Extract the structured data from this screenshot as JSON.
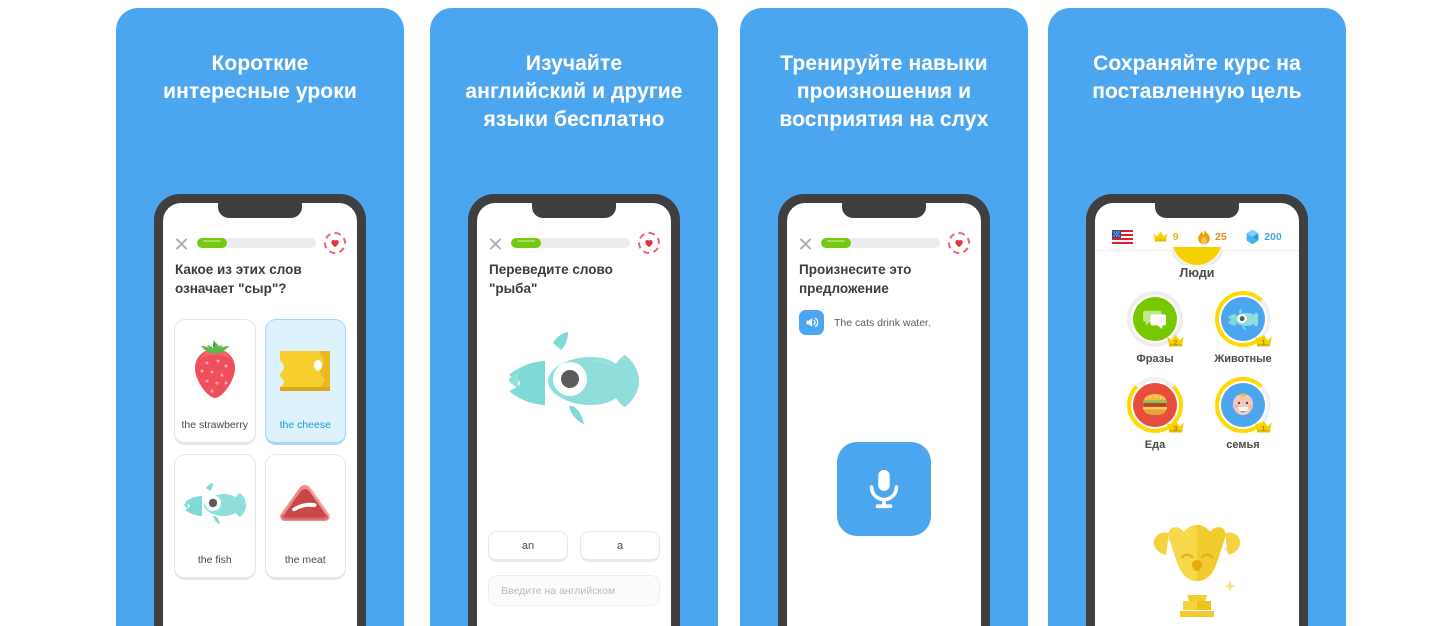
{
  "theme": {
    "panel_blue": "#4ca5ef",
    "phone_frame": "#3f3f3f",
    "progress_green": "#76c913",
    "heart_red": "#e8606a",
    "crown_gold": "#ffd900",
    "page_bg": "#ffffff"
  },
  "panels": [
    {
      "caption_lines": [
        "Короткие",
        "интересные уроки"
      ],
      "screen": {
        "kind": "multiple-choice",
        "close_icon": "close-icon",
        "progress_percent": 25,
        "hearts_icon": "heart-icon",
        "prompt_lines": [
          "Какое из этих слов",
          "означает \"сыр\"?"
        ],
        "choices": [
          {
            "label": "the strawberry",
            "art": "strawberry-illustration",
            "selected": false
          },
          {
            "label": "the cheese",
            "art": "cheese-illustration",
            "selected": true
          },
          {
            "label": "the fish",
            "art": "fish-illustration",
            "selected": false
          },
          {
            "label": "the meat",
            "art": "meat-illustration",
            "selected": false
          }
        ]
      }
    },
    {
      "caption_lines": [
        "Изучайте",
        "английский и другие",
        "языки бесплатно"
      ],
      "screen": {
        "kind": "translate",
        "close_icon": "close-icon",
        "progress_percent": 25,
        "hearts_icon": "heart-icon",
        "prompt_lines": [
          "Переведите слово \"рыба\""
        ],
        "illustration": "fish-illustration",
        "word_chips": [
          "an",
          "a"
        ],
        "input_placeholder": "Введите на английском",
        "input_value": ""
      }
    },
    {
      "caption_lines": [
        "Тренируйте навыки",
        "произношения и",
        "восприятия на слух"
      ],
      "screen": {
        "kind": "speak",
        "close_icon": "close-icon",
        "progress_percent": 25,
        "hearts_icon": "heart-icon",
        "prompt_lines": [
          "Произнесите это",
          "предложение"
        ],
        "speaker_icon": "speaker-icon",
        "sentence": "The cats drink water.",
        "mic_icon": "microphone-icon"
      }
    },
    {
      "caption_lines": [
        "Сохраняйте курс на",
        "поставленную цель"
      ],
      "screen": {
        "kind": "home",
        "stats": [
          {
            "icon": "us-flag-icon",
            "value": ""
          },
          {
            "icon": "crown-icon",
            "value": "9"
          },
          {
            "icon": "flame-icon",
            "value": "25"
          },
          {
            "icon": "gem-icon",
            "value": "200"
          }
        ],
        "section_title": "Люди",
        "skills": [
          {
            "name": "Фразы",
            "crown": "2",
            "color": "#78c800",
            "art": "speech-bubble-icon",
            "ring": "grey"
          },
          {
            "name": "Животные",
            "crown": "1",
            "color": "#4ca5ef",
            "art": "fish-icon",
            "ring": "gold"
          },
          {
            "name": "Еда",
            "crown": "3",
            "color": "#e84c3d",
            "art": "burger-icon",
            "ring": "gold2"
          },
          {
            "name": "семья",
            "crown": "1",
            "color": "#4ca5ef",
            "art": "baby-icon",
            "ring": "gold"
          }
        ],
        "trophy": "owl-trophy-icon"
      }
    }
  ]
}
